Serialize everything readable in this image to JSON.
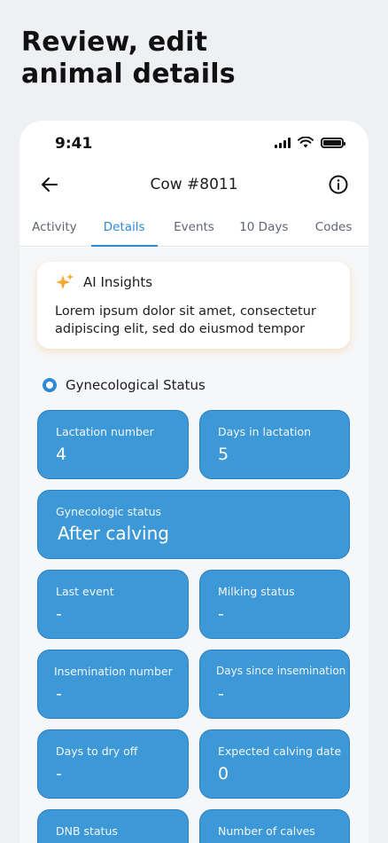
{
  "hero": {
    "line1": "Review, edit",
    "line2": "animal details"
  },
  "status_bar": {
    "time": "9:41"
  },
  "nav": {
    "title": "Cow #8011"
  },
  "tabs": [
    "Activity",
    "Details",
    "Events",
    "10 Days",
    "Codes"
  ],
  "active_tab": "Details",
  "ai_insights": {
    "title": "AI Insights",
    "body": "Lorem ipsum dolor sit amet, consectetur adipiscing elit, sed do eiusmod tempor"
  },
  "section": {
    "title": "Gynecological Status"
  },
  "fields": {
    "lactation_number": {
      "label": "Lactation number",
      "value": "4"
    },
    "days_in_lactation": {
      "label": "Days in lactation",
      "value": "5"
    },
    "gynecologic_status": {
      "label": "Gynecologic status",
      "value": "After calving"
    },
    "last_event": {
      "label": "Last event",
      "value": "-"
    },
    "milking_status": {
      "label": "Milking status",
      "value": "-"
    },
    "insemination_number": {
      "label": "Insemination number",
      "value": "-"
    },
    "days_since_insemination": {
      "label": "Days since insemination",
      "value": "-"
    },
    "days_to_dry_off": {
      "label": "Days to dry off",
      "value": "-"
    },
    "expected_calving_date": {
      "label": "Expected calving date",
      "value": "0"
    },
    "dnb_status": {
      "label": "DNB status",
      "value": ""
    },
    "number_of_calves": {
      "label": "Number of calves",
      "value": ""
    }
  },
  "colors": {
    "accent": "#2f8ad6",
    "tile": "#3d98d8",
    "background": "#eef0f3"
  },
  "icons": {
    "back": "arrow-left-icon",
    "info": "info-circle-icon",
    "ai": "sparkle-icon"
  }
}
